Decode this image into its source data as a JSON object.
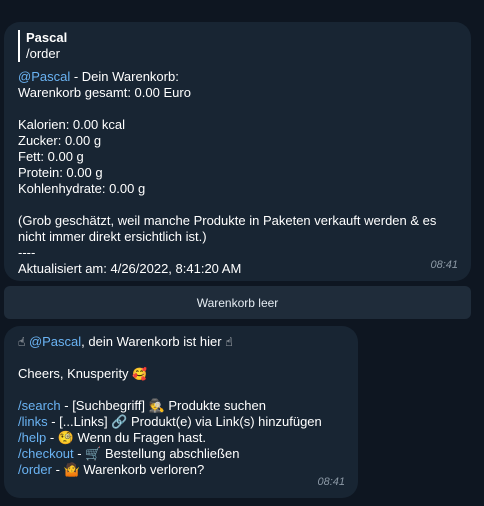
{
  "message1": {
    "quote": {
      "author": "Pascal",
      "text": "/order"
    },
    "mention": "@Pascal",
    "header_suffix": " - Dein Warenkorb:",
    "total": "Warenkorb gesamt: 0.00 Euro",
    "nutrition": [
      "Kalorien: 0.00 kcal",
      "Zucker: 0.00 g",
      "Fett: 0.00 g",
      "Protein: 0.00 g",
      "Kohlenhydrate: 0.00 g"
    ],
    "note": "(Grob geschätzt, weil manche Produkte in Paketen verkauft werden & es nicht immer direkt ersichtlich ist.)",
    "separator": "----",
    "updated": "Aktualisiert am: 4/26/2022, 8:41:20 AM",
    "time": "08:41"
  },
  "keyboard": {
    "button_label": "Warenkorb leer"
  },
  "message2": {
    "greeting_emoji": "☝",
    "mention": "@Pascal",
    "greeting_text": ", dein Warenkorb ist hier ",
    "greeting_emoji_end": "☝",
    "cheers": "Cheers, Knusperity ",
    "cheers_emoji": "🥰",
    "commands": [
      {
        "cmd": "/search",
        "text": " - [Suchbegriff] 🕵 Produkte suchen"
      },
      {
        "cmd": "/links",
        "text": " - [...Links] 🔗 Produkt(e) via Link(s) hinzufügen"
      },
      {
        "cmd": "/help",
        "text": " - 🧐 Wenn du Fragen hast."
      },
      {
        "cmd": "/checkout",
        "text": " - 🛒 Bestellung abschließen"
      },
      {
        "cmd": "/order",
        "text": " - 🤷 Warenkorb verloren?"
      }
    ],
    "time": "08:41"
  }
}
